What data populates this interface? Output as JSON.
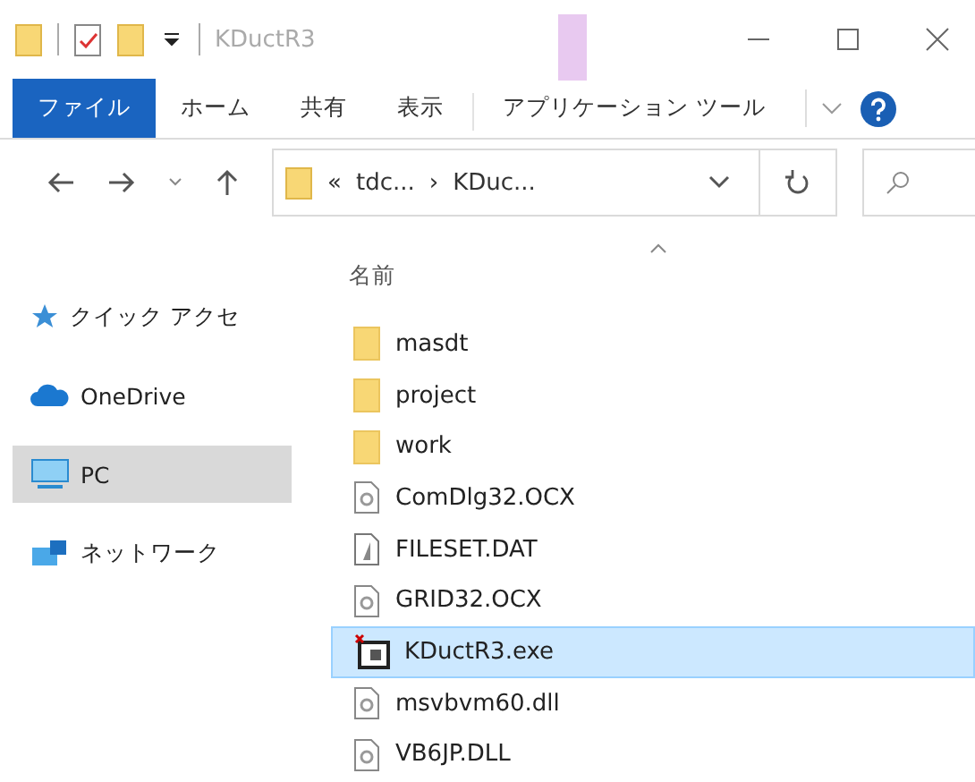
{
  "window": {
    "title": "KDuctR3"
  },
  "ribbon_tabs": [
    {
      "label": "ファイル",
      "kind": "file",
      "selected": true
    },
    {
      "label": "ホーム",
      "kind": "tab",
      "selected": false
    },
    {
      "label": "共有",
      "kind": "tab",
      "selected": false
    },
    {
      "label": "表示",
      "kind": "tab",
      "selected": false
    },
    {
      "label": "アプリケーション ツール",
      "kind": "context",
      "selected": false
    }
  ],
  "address": {
    "parts": [
      "«",
      "tdc...",
      "›",
      "KDuc..."
    ]
  },
  "column_header": "名前",
  "sidebar": {
    "items": [
      {
        "label": "クイック アクセ",
        "kind": "star",
        "selected": false
      },
      {
        "label": "OneDrive",
        "kind": "cloud",
        "selected": false
      },
      {
        "label": "PC",
        "kind": "pc",
        "selected": true
      },
      {
        "label": "ネットワーク",
        "kind": "network",
        "selected": false
      }
    ]
  },
  "files": [
    {
      "name": "masdt",
      "kind": "folder",
      "selected": false
    },
    {
      "name": "project",
      "kind": "folder",
      "selected": false
    },
    {
      "name": "work",
      "kind": "folder",
      "selected": false
    },
    {
      "name": "ComDlg32.OCX",
      "kind": "component",
      "selected": false
    },
    {
      "name": "FILESET.DAT",
      "kind": "document",
      "selected": false
    },
    {
      "name": "GRID32.OCX",
      "kind": "component",
      "selected": false
    },
    {
      "name": "KDuctR3.exe",
      "kind": "program",
      "selected": true
    },
    {
      "name": "msvbvm60.dll",
      "kind": "component",
      "selected": false
    },
    {
      "name": "VB6JP.DLL",
      "kind": "component",
      "selected": false
    }
  ]
}
